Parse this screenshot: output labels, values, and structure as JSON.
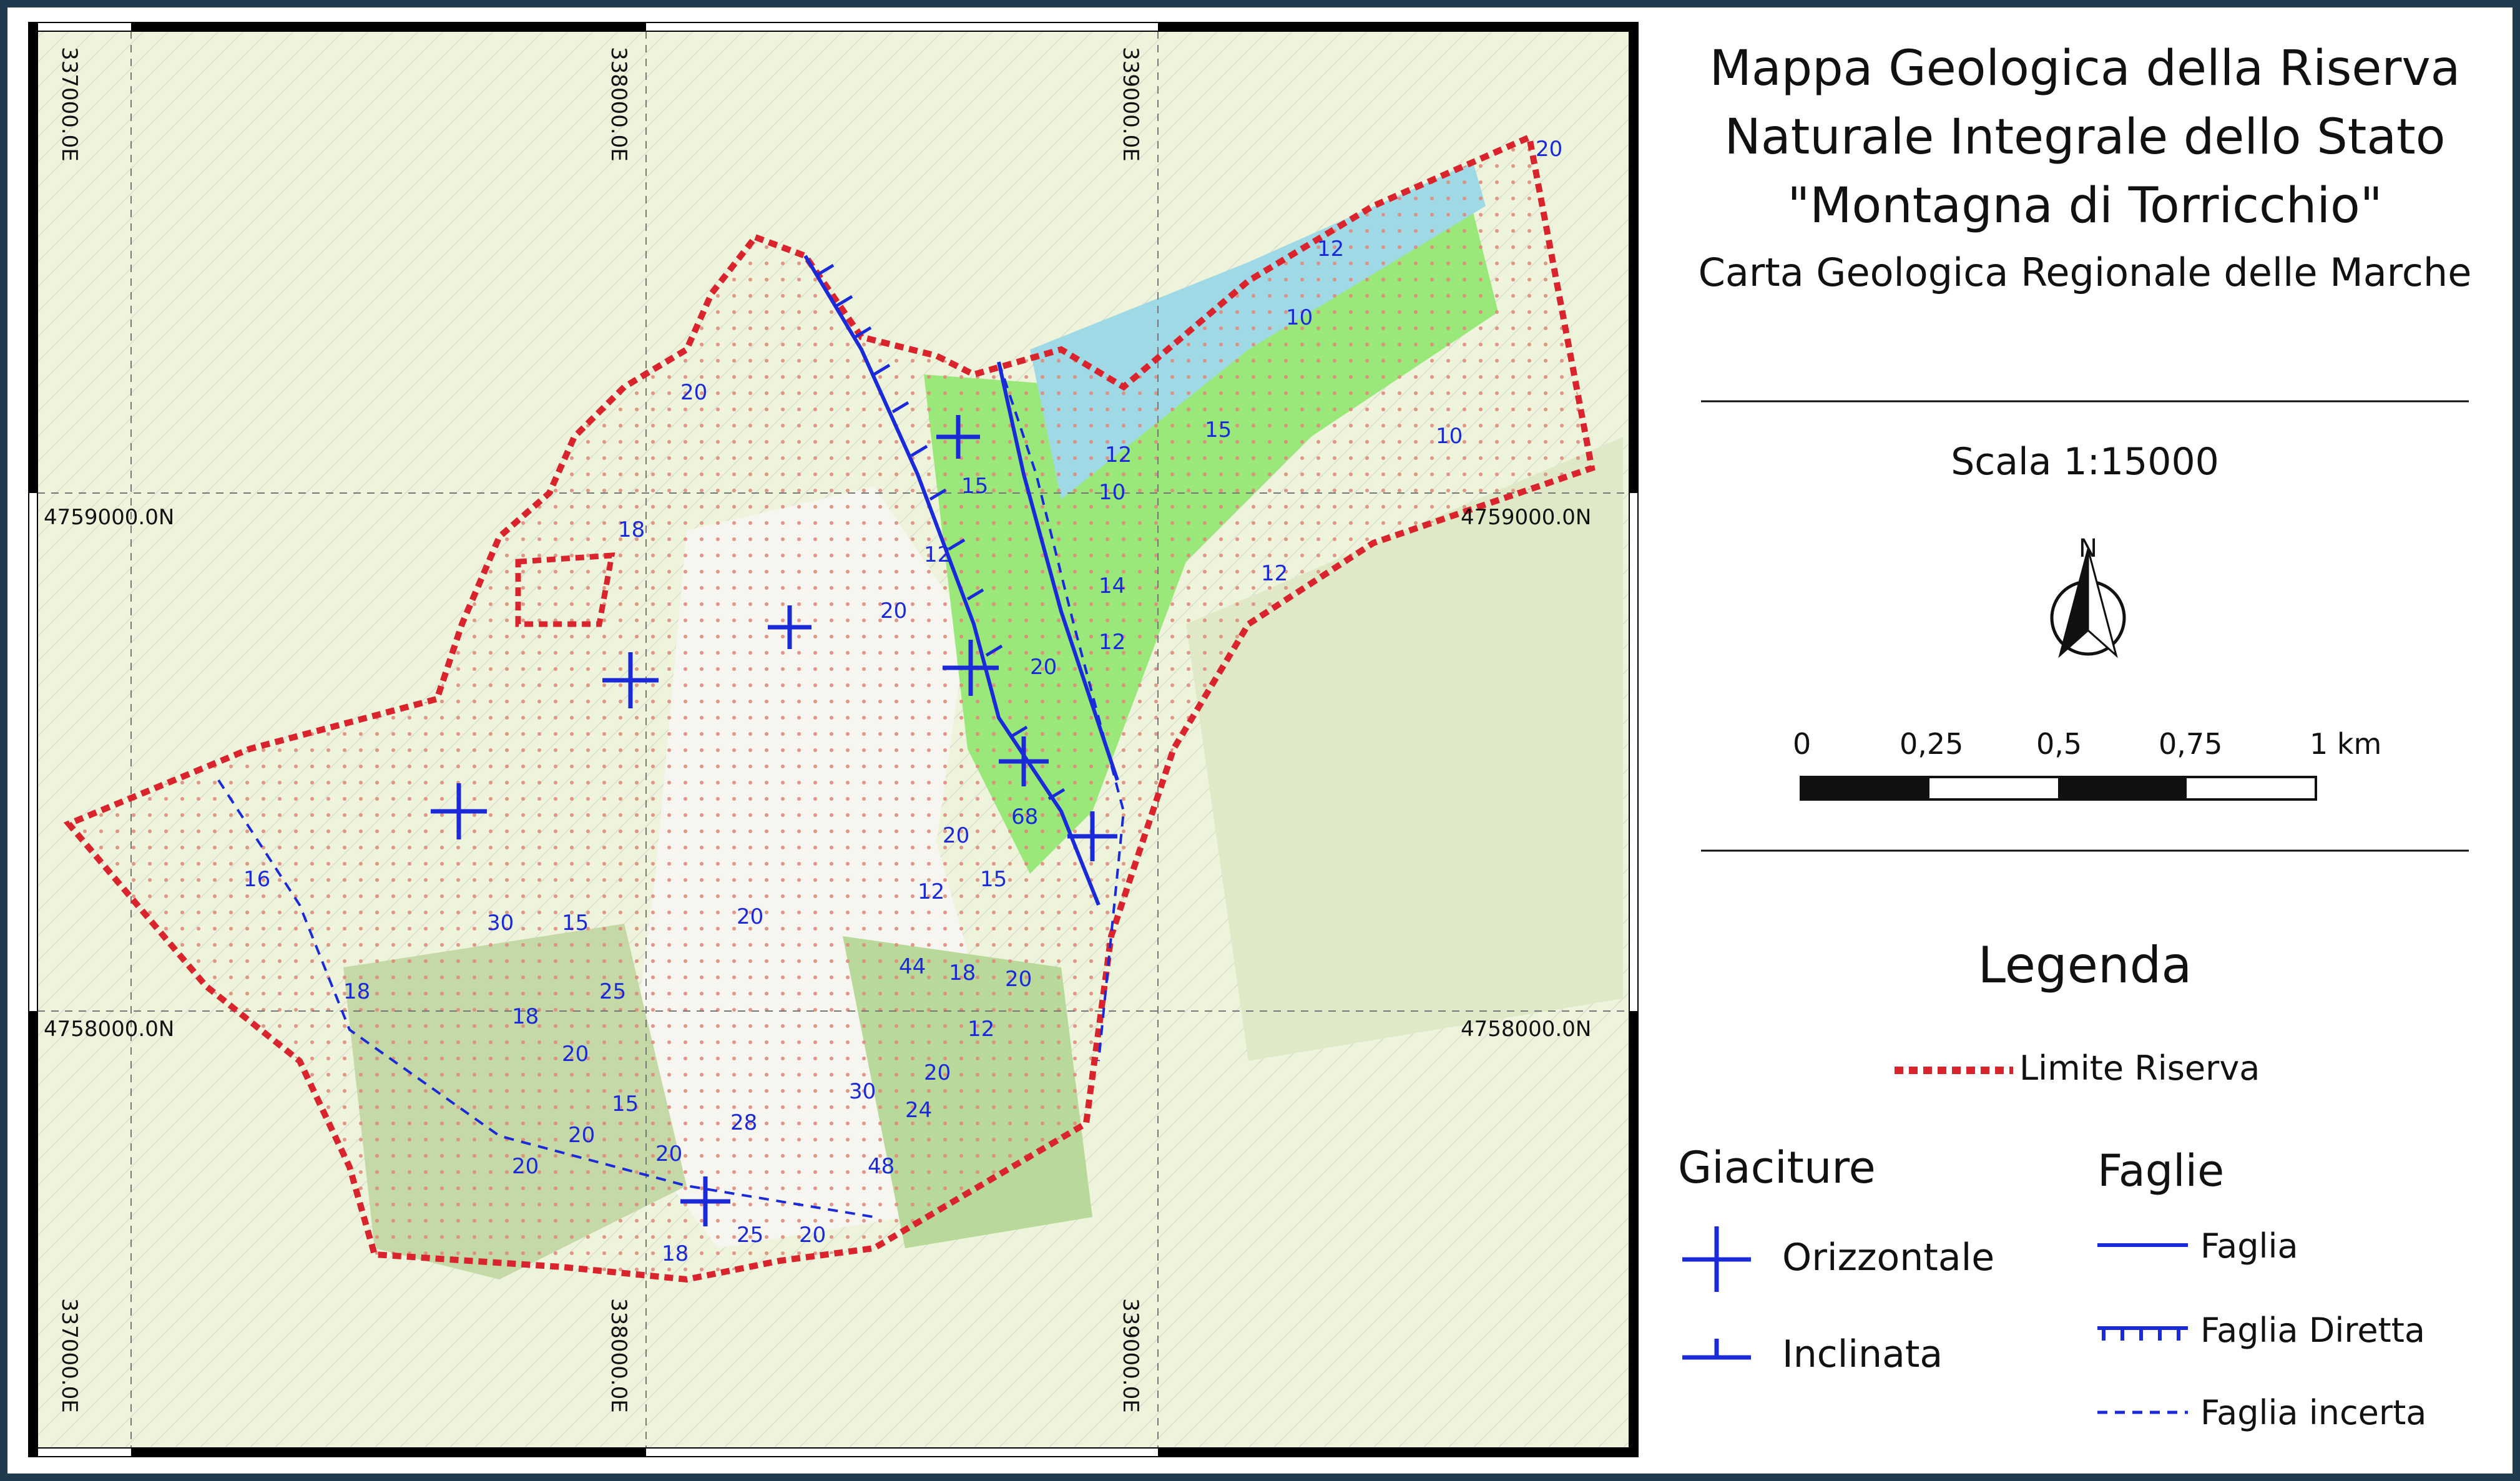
{
  "title_lines": [
    "Mappa Geologica della Riserva",
    "Naturale Integrale dello Stato",
    "\"Montagna di Torricchio\""
  ],
  "subtitle": "Carta Geologica Regionale delle Marche",
  "scale": {
    "label": "Scala 1:15000",
    "ticks": [
      "0",
      "0,25",
      "0,5",
      "0,75",
      "1 km"
    ]
  },
  "north_label": "N",
  "coordinates": {
    "x_top": [
      "337000.0E",
      "338000.0E",
      "339000.0E"
    ],
    "x_bottom": [
      "337000.0E",
      "338000.0E",
      "339000.0E"
    ],
    "y_left": [
      "4759000.0N",
      "4758000.0N"
    ],
    "y_right": [
      "4759000.0N",
      "4758000.0N"
    ]
  },
  "legend": {
    "title": "Legenda",
    "reserve_limit": "Limite Riserva",
    "giaciture": {
      "heading": "Giaciture",
      "orizzontale": "Orizzontale",
      "inclinata": "Inclinata"
    },
    "faglie": {
      "heading": "Faglie",
      "faglia": "Faglia",
      "diretta": "Faglia Diretta",
      "incerta": "Faglia incerta"
    }
  },
  "colors": {
    "reserve": "#d9232d",
    "structure": "#1a2ad8",
    "frame": "#1f3b4d"
  },
  "dip_values": [
    "20",
    "18",
    "20",
    "12",
    "15",
    "10",
    "12",
    "14",
    "12",
    "20",
    "10",
    "12",
    "10",
    "15",
    "12",
    "20",
    "16",
    "30",
    "15",
    "18",
    "25",
    "20",
    "18",
    "44",
    "12",
    "18",
    "20",
    "20",
    "12",
    "30",
    "24",
    "20",
    "48",
    "15",
    "20",
    "20",
    "28",
    "20",
    "18",
    "25",
    "20",
    "68",
    "15",
    "20"
  ]
}
